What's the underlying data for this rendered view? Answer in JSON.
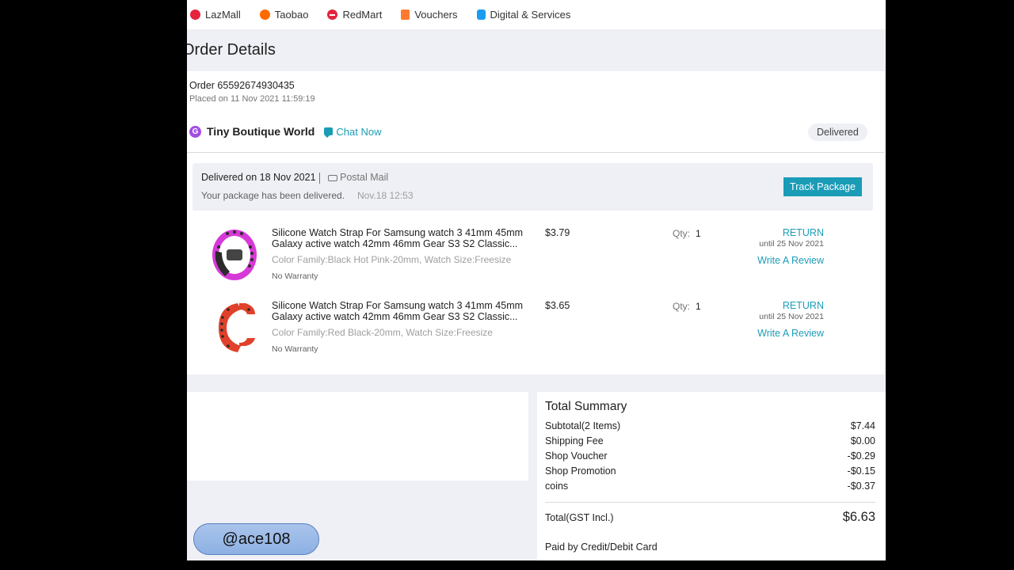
{
  "topnav": {
    "items": [
      {
        "label": "LazMall",
        "icon": "lazmall-icon"
      },
      {
        "label": "Taobao",
        "icon": "taobao-icon"
      },
      {
        "label": "RedMart",
        "icon": "redmart-icon"
      },
      {
        "label": "Vouchers",
        "icon": "voucher-icon"
      },
      {
        "label": "Digital & Services",
        "icon": "digital-services-icon"
      }
    ]
  },
  "page": {
    "title": "Order Details"
  },
  "order": {
    "number": "Order 65592674930435",
    "placed": "Placed on 11 Nov 2021 11:59:19",
    "seller": "Tiny Boutique World",
    "seller_initial": "G",
    "chat_label": "Chat Now",
    "status": "Delivered",
    "delivery": {
      "delivered_on": "Delivered on 18 Nov 2021",
      "method": "Postal Mail",
      "message": "Your package has been delivered.",
      "time": "Nov.18 12:53",
      "track_label": "Track Package"
    },
    "items": [
      {
        "title": "Silicone Watch Strap For Samsung watch 3 41mm 45mm Galaxy active watch 42mm 46mm Gear S3 S2 Classic...",
        "variant": "Color Family:Black Hot Pink-20mm, Watch Size:Freesize",
        "warranty": "No Warranty",
        "price": "$3.79",
        "qty_label": "Qty:",
        "qty": "1",
        "return_label": "RETURN",
        "return_until": "until 25 Nov 2021",
        "review_label": "Write A Review"
      },
      {
        "title": "Silicone Watch Strap For Samsung watch 3 41mm 45mm Galaxy active watch 42mm 46mm Gear S3 S2 Classic...",
        "variant": "Color Family:Red Black-20mm, Watch Size:Freesize",
        "warranty": "No Warranty",
        "price": "$3.65",
        "qty_label": "Qty:",
        "qty": "1",
        "return_label": "RETURN",
        "return_until": "until 25 Nov 2021",
        "review_label": "Write A Review"
      }
    ]
  },
  "summary": {
    "title": "Total Summary",
    "rows": [
      {
        "label": "Subtotal(2 Items)",
        "value": "$7.44"
      },
      {
        "label": "Shipping Fee",
        "value": "$0.00"
      },
      {
        "label": "Shop Voucher",
        "value": "-$0.29"
      },
      {
        "label": "Shop Promotion",
        "value": "-$0.15"
      },
      {
        "label": "coins",
        "value": "-$0.37"
      }
    ],
    "total_label": "Total(GST Incl.)",
    "total_value": "$6.63",
    "paid_by": "Paid by Credit/Debit Card"
  },
  "watermark": {
    "handle": "@ace108"
  },
  "colors": {
    "accent": "#1a9cb7",
    "page_bg": "#eff0f5",
    "strap1_primary": "#d63ad6",
    "strap1_secondary": "#2b2b2b",
    "strap2_primary": "#e0412b",
    "strap2_secondary": "#2b2b2b"
  }
}
